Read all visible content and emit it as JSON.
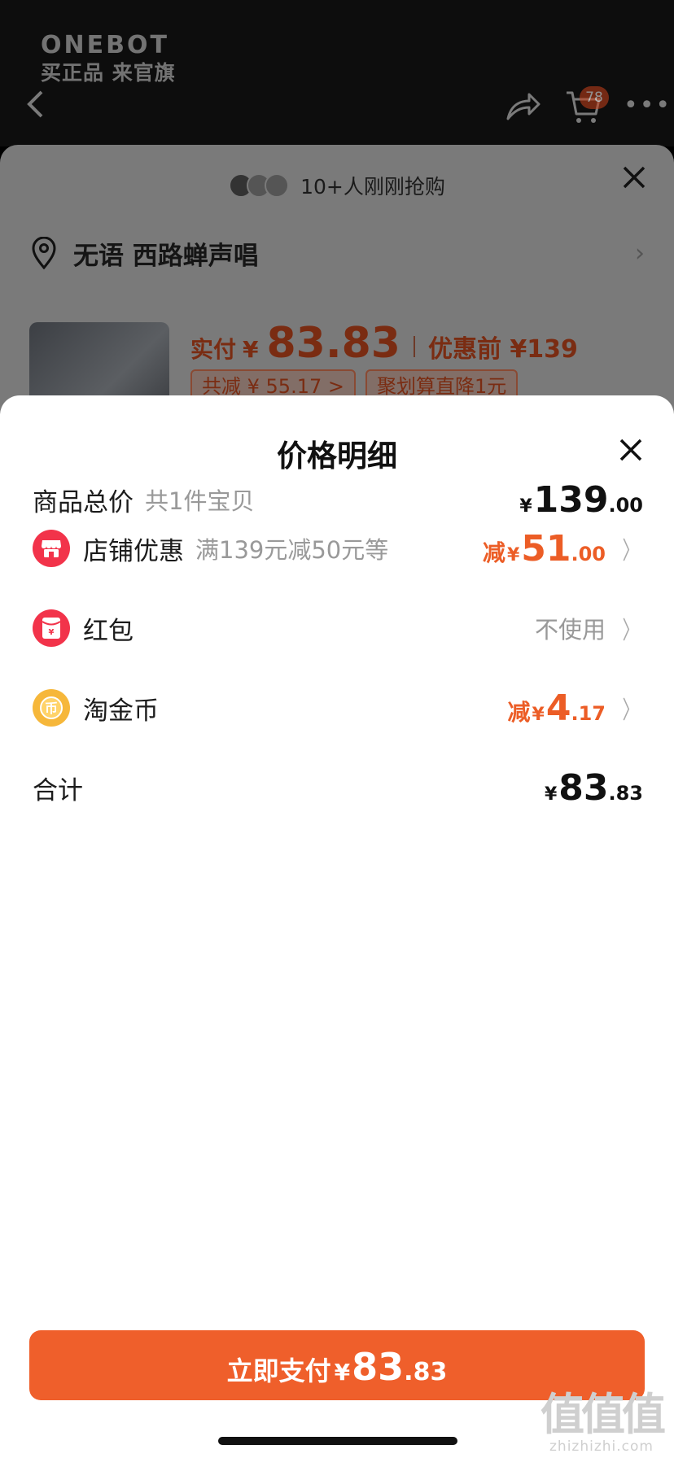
{
  "background": {
    "brand": {
      "name": "ONEBOT",
      "slogan": "买正品 来官旗"
    },
    "cart_badge": "78",
    "buyers_text": "10+人刚刚抢购",
    "address": "无语 西路蝉声唱",
    "product": {
      "price_label": "实付",
      "currency": "¥",
      "price": "83.83",
      "orig_price": "优惠前 ¥139",
      "chips": [
        "共减 ¥ 55.17 >",
        "聚划算直降1元"
      ]
    }
  },
  "modal": {
    "title": "价格明细",
    "total_price": {
      "label": "商品总价",
      "sub": "共1件宝贝",
      "currency": "¥",
      "int": "139",
      "dec": ".00"
    },
    "shop_discount": {
      "label": "店铺优惠",
      "sub": "满139元减50元等",
      "prefix": "减",
      "currency": "¥",
      "int": "51",
      "dec": ".00"
    },
    "red_packet": {
      "label": "红包",
      "value": "不使用"
    },
    "taojinbi": {
      "label": "淘金币",
      "prefix": "减",
      "currency": "¥",
      "int": "4",
      "dec": ".17"
    },
    "sum": {
      "label": "合计",
      "currency": "¥",
      "int": "83",
      "dec": ".83"
    },
    "pay_button": {
      "label": "立即支付",
      "currency": "¥",
      "int": "83",
      "dec": ".83"
    }
  },
  "watermark": {
    "big": "值值值",
    "small": "zhizhizhi.com"
  },
  "colors": {
    "accent": "#ef5f2b",
    "discount": "#ec5d26",
    "shop_icon": "#f2334a",
    "coin_icon": "#f6b73a"
  },
  "icons": [
    "back-icon",
    "share-icon",
    "cart-icon",
    "more-icon",
    "close-icon",
    "location-pin-icon",
    "chevron-right-icon",
    "shop-icon",
    "red-packet-icon",
    "coin-icon"
  ]
}
